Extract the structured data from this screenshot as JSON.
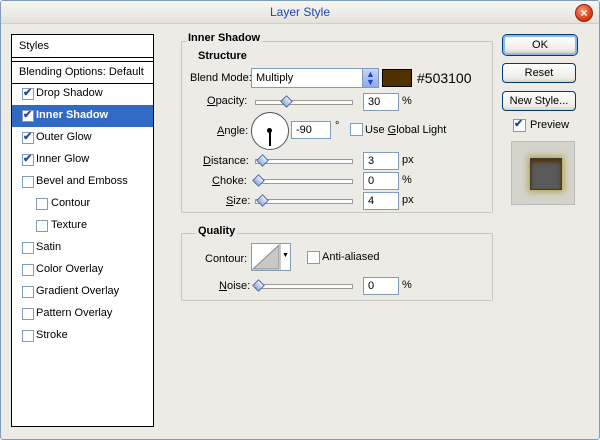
{
  "window": {
    "title": "Layer Style"
  },
  "styles_panel": {
    "header": "Styles",
    "blending_options": "Blending Options: Default",
    "items": [
      {
        "label": "Drop Shadow",
        "checked": true,
        "selected": false,
        "indent": false
      },
      {
        "label": "Inner Shadow",
        "checked": true,
        "selected": true,
        "indent": false
      },
      {
        "label": "Outer Glow",
        "checked": true,
        "selected": false,
        "indent": false
      },
      {
        "label": "Inner Glow",
        "checked": true,
        "selected": false,
        "indent": false
      },
      {
        "label": "Bevel and Emboss",
        "checked": false,
        "selected": false,
        "indent": false
      },
      {
        "label": "Contour",
        "checked": false,
        "selected": false,
        "indent": true
      },
      {
        "label": "Texture",
        "checked": false,
        "selected": false,
        "indent": true
      },
      {
        "label": "Satin",
        "checked": false,
        "selected": false,
        "indent": false
      },
      {
        "label": "Color Overlay",
        "checked": false,
        "selected": false,
        "indent": false
      },
      {
        "label": "Gradient Overlay",
        "checked": false,
        "selected": false,
        "indent": false
      },
      {
        "label": "Pattern Overlay",
        "checked": false,
        "selected": false,
        "indent": false
      },
      {
        "label": "Stroke",
        "checked": false,
        "selected": false,
        "indent": false
      }
    ]
  },
  "inner_shadow": {
    "title": "Inner Shadow",
    "structure": {
      "title": "Structure",
      "blend_mode_label": "Blend Mode:",
      "blend_mode_value": "Multiply",
      "color_hex": "#503100",
      "color_label": "#503100",
      "opacity_label": "Opacity:",
      "opacity_value": "30",
      "opacity_unit": "%",
      "opacity_level": 0.3,
      "angle_label": "Angle:",
      "angle_value": "-90",
      "angle_unit": "°",
      "use_global_light_label": "Use Global Light",
      "use_global_light": false,
      "distance_label": "Distance:",
      "distance_value": "3",
      "distance_unit": "px",
      "choke_label": "Choke:",
      "choke_value": "0",
      "choke_unit": "%",
      "size_label": "Size:",
      "size_value": "4",
      "size_unit": "px"
    },
    "quality": {
      "title": "Quality",
      "contour_label": "Contour:",
      "anti_aliased_label": "Anti-aliased",
      "anti_aliased": false,
      "noise_label": "Noise:",
      "noise_value": "0",
      "noise_unit": "%"
    }
  },
  "buttons": {
    "ok": "OK",
    "reset": "Reset",
    "new_style": "New Style...",
    "preview_label": "Preview",
    "preview_checked": true
  },
  "icons": {
    "close": "close-icon",
    "checkmark": "checkmark-icon",
    "dropdown_arrow": "chevron-updown-icon"
  }
}
